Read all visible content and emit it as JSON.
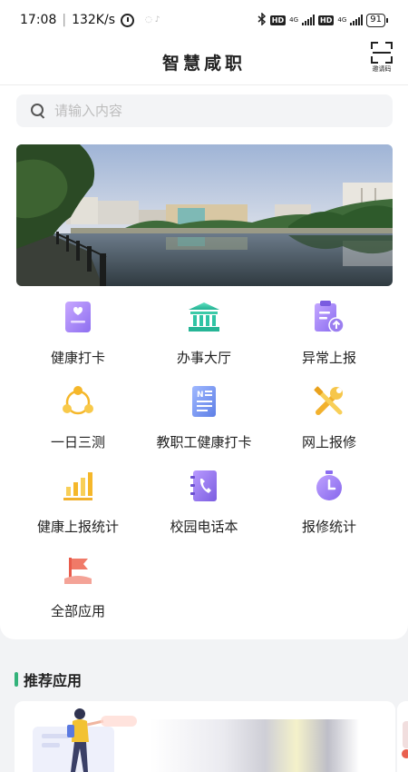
{
  "status_bar": {
    "time": "17:08",
    "separator": "|",
    "speed": "132K/s",
    "notif_icons": "◌  ♪",
    "hd": "HD",
    "net": "4G",
    "battery": "91"
  },
  "header": {
    "title": "智慧咸职",
    "invite_label": "邀请码"
  },
  "search": {
    "placeholder": "请输入内容",
    "value": ""
  },
  "apps": [
    {
      "label": "健康打卡",
      "icon": "health-card-icon"
    },
    {
      "label": "办事大厅",
      "icon": "hall-building-icon"
    },
    {
      "label": "异常上报",
      "icon": "clipboard-upload-icon"
    },
    {
      "label": "一日三测",
      "icon": "three-dots-cycle-icon"
    },
    {
      "label": "教职工健康打卡",
      "icon": "staff-document-icon"
    },
    {
      "label": "网上报修",
      "icon": "wrench-tools-icon"
    },
    {
      "label": "健康上报统计",
      "icon": "bar-chart-icon"
    },
    {
      "label": "校园电话本",
      "icon": "phone-book-icon"
    },
    {
      "label": "报修统计",
      "icon": "stopwatch-icon"
    },
    {
      "label": "全部应用",
      "icon": "flag-icon"
    }
  ],
  "recommend": {
    "title": "推荐应用"
  },
  "colors": {
    "accent_green": "#33b27a",
    "purple": "#9b7ef0",
    "teal": "#2fc4a5",
    "yellow": "#f5b72a",
    "blue": "#6d8ff0",
    "red": "#ee6b5c"
  }
}
